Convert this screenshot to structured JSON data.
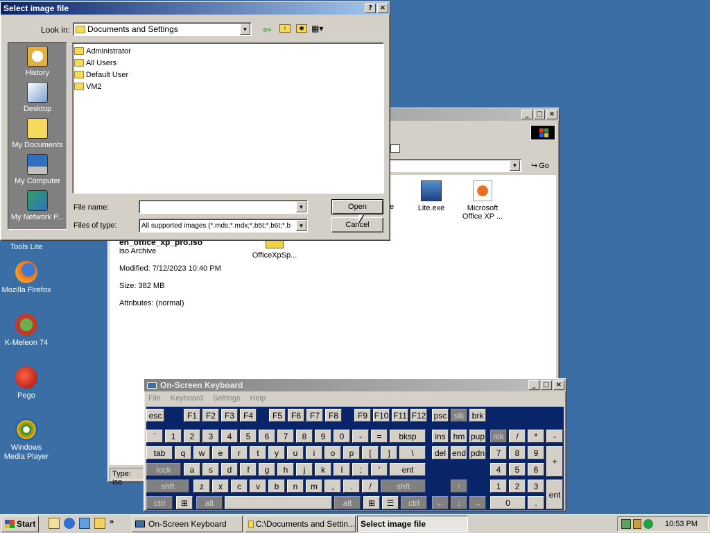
{
  "desktop": {
    "icons": [
      {
        "label": "DAEMON Tools Lite",
        "icon": "daemon-tools-icon"
      },
      {
        "label": "Mozilla Firefox",
        "icon": "firefox-icon"
      },
      {
        "label": "K-Meleon 74",
        "icon": "k-meleon-icon"
      },
      {
        "label": "Pego",
        "icon": "pego-icon"
      },
      {
        "label": "Windows Media Player",
        "icon": "media-player-icon"
      }
    ]
  },
  "explorer": {
    "go_label": "Go",
    "files": [
      {
        "name": "Lite.exe"
      },
      {
        "name": "Microsoft Office XP ..."
      },
      {
        "name": "OfficeXpSp..."
      }
    ],
    "partial_label": "e",
    "details": {
      "name": "en_office_xp_pro.iso",
      "type": "iso Archive",
      "modified": "Modified: 7/12/2023 10:40 PM",
      "size": "Size: 382 MB",
      "attributes": "Attributes: (normal)"
    },
    "status": "Type: iso"
  },
  "dialog": {
    "title": "Select image file",
    "look_in_label": "Look in:",
    "look_in_value": "Documents and Settings",
    "places": [
      {
        "label": "History",
        "icon": "history-icon"
      },
      {
        "label": "Desktop",
        "icon": "desktop-icon"
      },
      {
        "label": "My Documents",
        "icon": "my-documents-icon"
      },
      {
        "label": "My Computer",
        "icon": "my-computer-icon"
      },
      {
        "label": "My Network P...",
        "icon": "network-places-icon"
      }
    ],
    "files": [
      "Administrator",
      "All Users",
      "Default User",
      "VM2"
    ],
    "file_name_label": "File name:",
    "file_name_value": "",
    "file_type_label": "Files of type:",
    "file_type_value": "All supported images (*.mds;*.mdx;*.b5t;*.b6t;*.b",
    "open_label": "Open",
    "cancel_label": "Cancel"
  },
  "osk": {
    "title": "On-Screen Keyboard",
    "menu": [
      "File",
      "Keyboard",
      "Settings",
      "Help"
    ]
  },
  "taskbar": {
    "start_label": "Start",
    "tasks": [
      {
        "label": "On-Screen Keyboard"
      },
      {
        "label": "C:\\Documents and Settin..."
      },
      {
        "label": "Select image file"
      }
    ],
    "clock": "10:53 PM"
  }
}
